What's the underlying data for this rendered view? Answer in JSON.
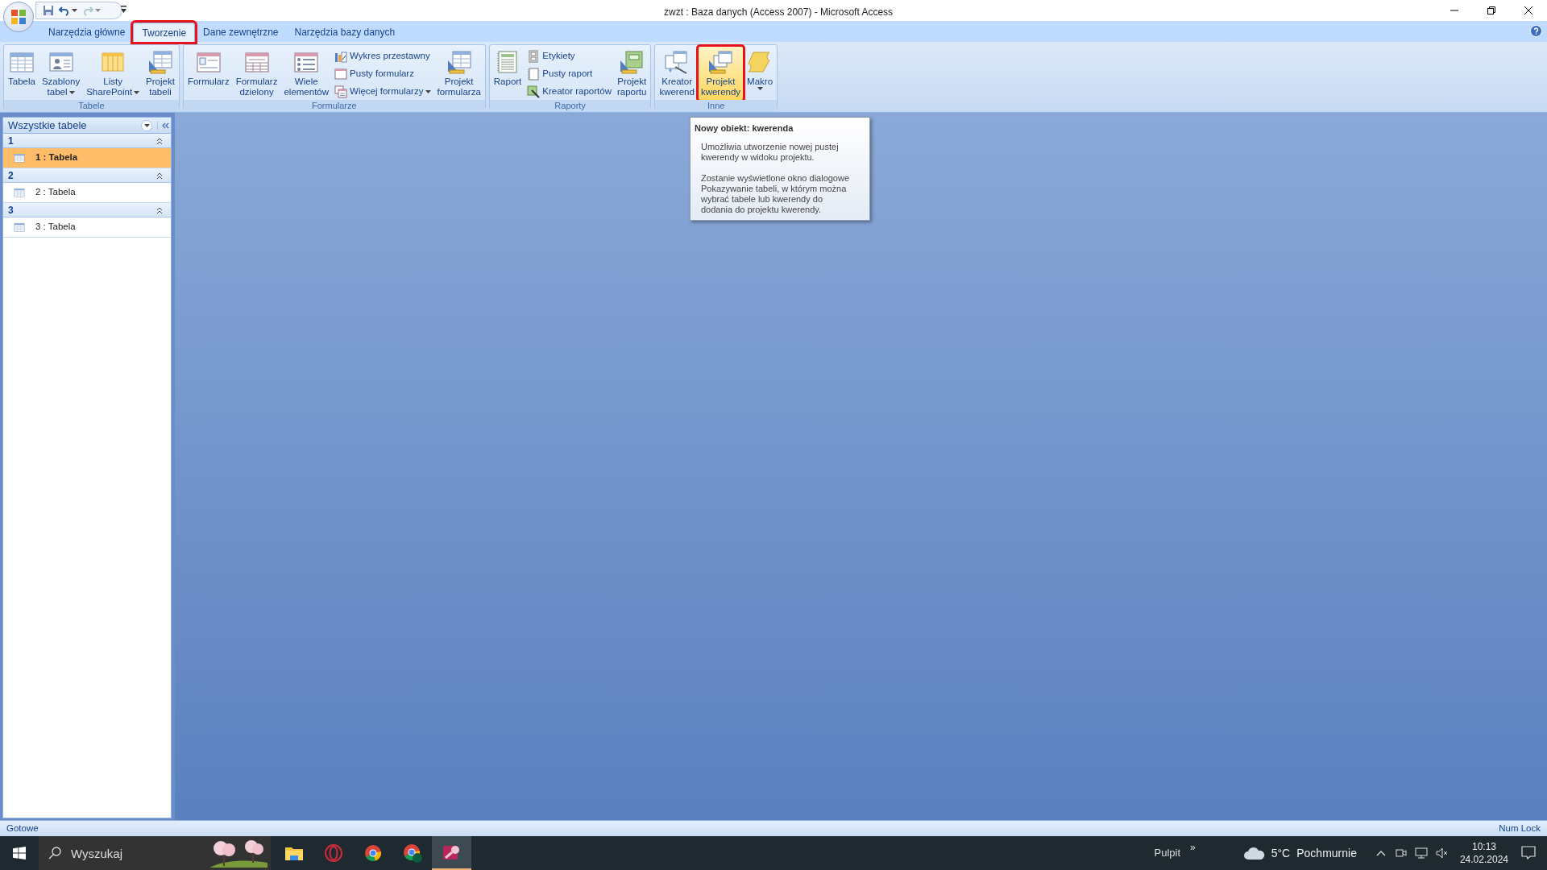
{
  "window": {
    "title": "zwzt : Baza danych (Access 2007) - Microsoft Access"
  },
  "ribbon_tabs": [
    {
      "label": "Narzędzia główne",
      "selected": false,
      "highlighted": false
    },
    {
      "label": "Tworzenie",
      "selected": true,
      "highlighted": true
    },
    {
      "label": "Dane zewnętrzne",
      "selected": false,
      "highlighted": false
    },
    {
      "label": "Narzędzia bazy danych",
      "selected": false,
      "highlighted": false
    }
  ],
  "ribbon_groups": [
    {
      "label": "Tabele",
      "items": [
        {
          "kind": "large",
          "lines": [
            "Tabela"
          ],
          "dropdown": false,
          "highlighted": false
        },
        {
          "kind": "large",
          "lines": [
            "Szablony",
            "tabel"
          ],
          "dropdown": true,
          "highlighted": false
        },
        {
          "kind": "large",
          "lines": [
            "Listy",
            "SharePoint"
          ],
          "dropdown": true,
          "highlighted": false
        },
        {
          "kind": "large",
          "lines": [
            "Projekt",
            "tabeli"
          ],
          "dropdown": false,
          "highlighted": false
        }
      ]
    },
    {
      "label": "Formularze",
      "items": [
        {
          "kind": "large",
          "lines": [
            "Formularz"
          ],
          "dropdown": false,
          "highlighted": false
        },
        {
          "kind": "large",
          "lines": [
            "Formularz",
            "dzielony"
          ],
          "dropdown": false,
          "highlighted": false
        },
        {
          "kind": "large",
          "lines": [
            "Wiele",
            "elementów"
          ],
          "dropdown": false,
          "highlighted": false
        },
        {
          "kind": "small",
          "lines": [
            "Wykres przestawny"
          ],
          "dropdown": false,
          "highlighted": false
        },
        {
          "kind": "small",
          "lines": [
            "Pusty formularz"
          ],
          "dropdown": false,
          "highlighted": false
        },
        {
          "kind": "small",
          "lines": [
            "Więcej formularzy"
          ],
          "dropdown": true,
          "highlighted": false
        },
        {
          "kind": "large",
          "lines": [
            "Projekt",
            "formularza"
          ],
          "dropdown": false,
          "highlighted": false
        }
      ]
    },
    {
      "label": "Raporty",
      "items": [
        {
          "kind": "large",
          "lines": [
            "Raport"
          ],
          "dropdown": false,
          "highlighted": false
        },
        {
          "kind": "small",
          "lines": [
            "Etykiety"
          ],
          "dropdown": false,
          "highlighted": false
        },
        {
          "kind": "small",
          "lines": [
            "Pusty raport"
          ],
          "dropdown": false,
          "highlighted": false
        },
        {
          "kind": "small",
          "lines": [
            "Kreator raportów"
          ],
          "dropdown": false,
          "highlighted": false
        },
        {
          "kind": "large",
          "lines": [
            "Projekt",
            "raportu"
          ],
          "dropdown": false,
          "highlighted": false
        }
      ]
    },
    {
      "label": "Inne",
      "items": [
        {
          "kind": "large",
          "lines": [
            "Kreator",
            "kwerend"
          ],
          "dropdown": false,
          "highlighted": false
        },
        {
          "kind": "large",
          "lines": [
            "Projekt",
            "kwerendy"
          ],
          "dropdown": false,
          "highlighted": true
        },
        {
          "kind": "large",
          "lines": [
            "Makro"
          ],
          "dropdown": true,
          "highlighted": false
        }
      ]
    }
  ],
  "navigation_pane": {
    "title": "Wszystkie tabele",
    "groups": [
      {
        "label": "1",
        "expanded": true,
        "items": [
          {
            "label": "1 : Tabela",
            "selected": true
          }
        ]
      },
      {
        "label": "2",
        "expanded": true,
        "items": [
          {
            "label": "2 : Tabela",
            "selected": false
          }
        ]
      },
      {
        "label": "3",
        "expanded": true,
        "items": [
          {
            "label": "3 : Tabela",
            "selected": false
          }
        ]
      }
    ]
  },
  "tooltip": {
    "title": "Nowy obiekt: kwerenda",
    "paragraphs": [
      "Umożliwia utworzenie nowej pustej kwerendy w widoku projektu.",
      "Zostanie wyświetlone okno dialogowe Pokazywanie tabeli, w którym można wybrać tabele lub kwerendy do dodania do projektu kwerendy."
    ]
  },
  "status_bar": {
    "left": "Gotowe",
    "right": "Num Lock"
  },
  "taskbar": {
    "search": {
      "placeholder": "Wyszukaj"
    },
    "apps": [
      {
        "selected": false
      },
      {
        "selected": false
      },
      {
        "selected": false
      },
      {
        "selected": false
      },
      {
        "selected": true
      }
    ],
    "desktop_label": "Pulpit",
    "desktop_chevron": "»",
    "temperature": "5°C",
    "weather": "Pochmurnie",
    "time": "10:13",
    "date": "24.02.2024"
  }
}
